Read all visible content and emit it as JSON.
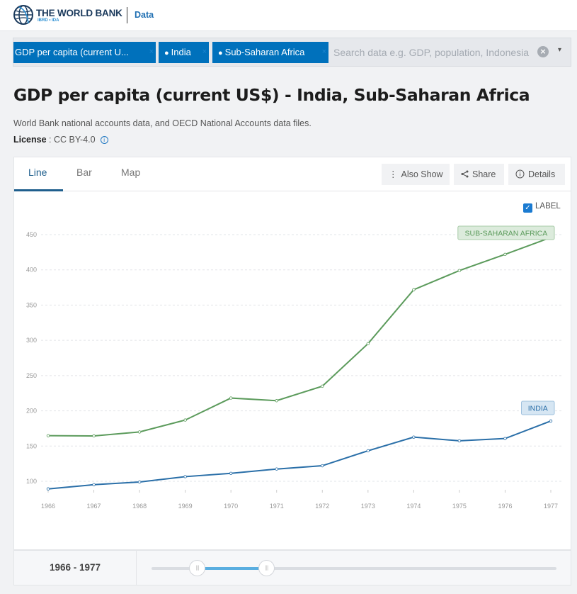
{
  "header": {
    "brand": "THE WORLD BANK",
    "brand_sub": "IBRD • IDA",
    "section": "Data"
  },
  "search": {
    "chips": [
      {
        "label": "GDP per capita (current U...",
        "icon": "none"
      },
      {
        "label": "India",
        "icon": "map-pin-icon"
      },
      {
        "label": "Sub-Saharan Africa",
        "icon": "map-pin-icon"
      }
    ],
    "chip_remove": "×",
    "placeholder": "Search data e.g. GDP, population, Indonesia",
    "clear": "×",
    "dropdown": "▾"
  },
  "page": {
    "title": "GDP per capita (current US$) - India, Sub-Saharan Africa",
    "source": "World Bank national accounts data, and OECD National Accounts data files.",
    "license_label": "License",
    "license_value": " : CC BY-4.0",
    "info": "i"
  },
  "tabs": [
    {
      "label": "Line",
      "active": true
    },
    {
      "label": "Bar",
      "active": false
    },
    {
      "label": "Map",
      "active": false
    }
  ],
  "toolbar": {
    "also_show": "Also Show",
    "share": "Share",
    "details": "Details"
  },
  "label_toggle": {
    "label": "LABEL",
    "checked": true
  },
  "colors": {
    "india": "#2a6fa8",
    "ssa": "#5c9b5c",
    "accent": "#0071bc",
    "slider_fill": "#5aaee0"
  },
  "chart_data": {
    "type": "line",
    "title": "GDP per capita (current US$) - India, Sub-Saharan Africa",
    "xlabel": "",
    "ylabel": "",
    "x": [
      1966,
      1967,
      1968,
      1969,
      1970,
      1971,
      1972,
      1973,
      1974,
      1975,
      1976,
      1977
    ],
    "yticks": [
      100,
      150,
      200,
      250,
      300,
      350,
      400,
      450
    ],
    "ylim": [
      85,
      455
    ],
    "grid": true,
    "legend": "inline-labels-at-end",
    "series": [
      {
        "name": "SUB-SAHARAN AFRICA",
        "color": "#5c9b5c",
        "label_bg": "#dcebdc",
        "label_border": "#a9cba9",
        "values": [
          164.7,
          164.4,
          170.0,
          186.9,
          218.1,
          214.4,
          234.9,
          295.3,
          371.8,
          399.0,
          422.0,
          446.0
        ]
      },
      {
        "name": "INDIA",
        "color": "#2a6fa8",
        "label_bg": "#d6e6f3",
        "label_border": "#9fc1de",
        "values": [
          89.2,
          95.2,
          99.0,
          106.6,
          111.3,
          117.4,
          122.1,
          143.3,
          162.7,
          157.4,
          160.7,
          185.5
        ]
      }
    ]
  },
  "range": {
    "label": "1966 - 1977",
    "start_fraction": 0.112,
    "end_fraction": 0.283,
    "handle_grip": "|||"
  }
}
